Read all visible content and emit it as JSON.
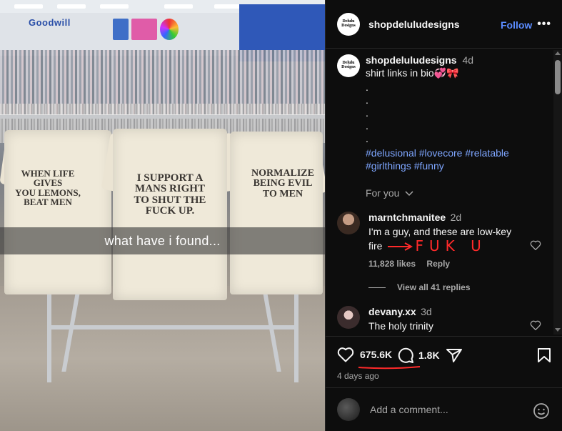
{
  "photo": {
    "store_sign": "Goodwill",
    "overlay_caption": "what have i found...",
    "shirts": [
      "WHEN LIFE GIVES\nYOU LEMONS,\nBEAT MEN",
      "I SUPPORT A\nMANS RIGHT\nTO SHUT THE\nFUCK UP.",
      "NORMALIZE\nBEING EVIL\nTO MEN"
    ]
  },
  "header": {
    "avatar_text": "Delulu\nDesigns",
    "username": "shopdeluludesigns",
    "follow_label": "Follow",
    "more_label": "•••"
  },
  "caption": {
    "username": "shopdeluludesigns",
    "time": "4d",
    "text": "shirt links in bio💞🎀",
    "dots": [
      ".",
      ".",
      ".",
      ".",
      "."
    ],
    "hashtags_line1": "#delusional #lovecore #relatable",
    "hashtags_line2": "#girlthings #funny",
    "for_you": "For you"
  },
  "comments": [
    {
      "username": "marntchmanitee",
      "time": "2d",
      "text_line1": "I'm a guy, and these are low-key",
      "text_line2": "fire",
      "annotation": "FUK U",
      "likes": "11,828 likes",
      "reply": "Reply",
      "view_replies": "View all 41 replies"
    },
    {
      "username": "devany.xx",
      "time": "3d",
      "text_line1": "The holy trinity"
    }
  ],
  "actions": {
    "likes": "675.6K",
    "comments": "1.8K",
    "time_ago": "4 days ago"
  },
  "add_comment": {
    "placeholder": "Add a comment..."
  },
  "colors": {
    "accent": "#5b8cff",
    "hashtag": "#7ea6ff",
    "annotation": "#ff2a2a"
  }
}
